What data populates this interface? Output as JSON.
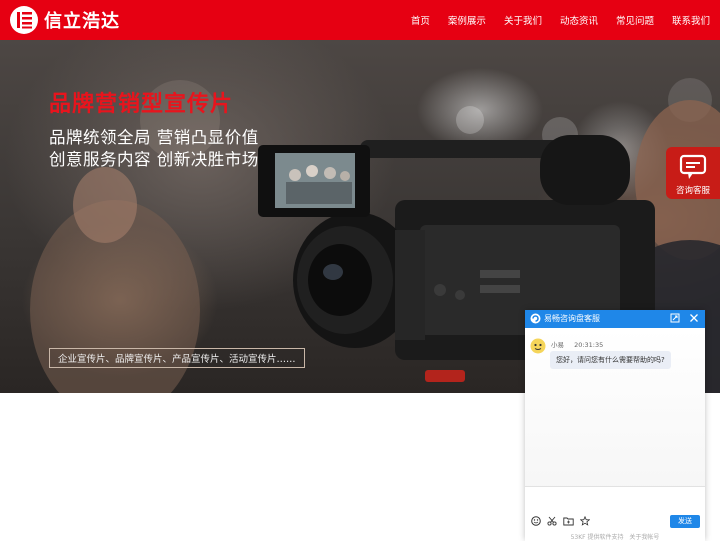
{
  "header": {
    "logo_text": "信立浩达",
    "nav": [
      "首页",
      "案例展示",
      "关于我们",
      "动态资讯",
      "常见问题",
      "联系我们"
    ]
  },
  "hero": {
    "title": "品牌营销型宣传片",
    "line1": "品牌统领全局 营销凸显价值",
    "line2": "创意服务内容 创新决胜市场",
    "tags": "企业宣传片、品牌宣传片、产品宣传片、活动宣传片……"
  },
  "float_button": {
    "label": "咨询客服",
    "icon": "chat-bubble-icon"
  },
  "chat": {
    "title": "易畅咨询盘客服",
    "agent_name": "小易",
    "time": "20:31:35",
    "message": "您好，请问您有什么需要帮助的吗?",
    "send_label": "发送",
    "tools": [
      "emoji-icon",
      "scissors-icon",
      "folder-icon",
      "star-icon"
    ],
    "powered_by": "53KF 提供软件支持",
    "about": "关于我帐号"
  },
  "colors": {
    "brand": "#e60012",
    "chat_accent": "#1f87e8",
    "float_button": "#c81c17"
  }
}
